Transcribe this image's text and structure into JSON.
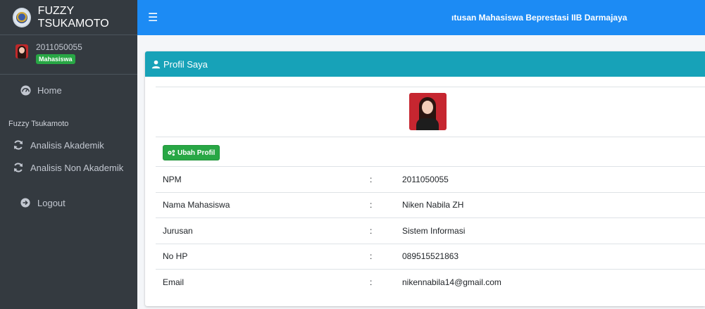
{
  "brand": {
    "name": "FUZZY TSUKAMOTO"
  },
  "user": {
    "id": "2011050055",
    "role_badge": "Mahasiswa"
  },
  "sidebar": {
    "home": "Home",
    "section_header": "Fuzzy Tsukamoto",
    "items": [
      {
        "label": "Analisis Akademik",
        "icon": "sync-icon"
      },
      {
        "label": "Analisis Non Akademik",
        "icon": "sync-icon"
      }
    ],
    "logout": "Logout"
  },
  "topbar": {
    "title": "ıtusan Mahasiswa Beprestasi IIB Darmajaya"
  },
  "card": {
    "header": "Profil Saya",
    "edit_button": "Ubah Profil",
    "fields": [
      {
        "label": "NPM",
        "sep": ":",
        "value": "2011050055"
      },
      {
        "label": "Nama Mahasiswa",
        "sep": ":",
        "value": "Niken Nabila ZH"
      },
      {
        "label": "Jurusan",
        "sep": ":",
        "value": "Sistem Informasi"
      },
      {
        "label": "No HP",
        "sep": ":",
        "value": "089515521863"
      },
      {
        "label": "Email",
        "sep": ":",
        "value": "nikennabila14@gmail.com"
      }
    ]
  },
  "colors": {
    "sidebar": "#343a40",
    "topbar": "#1c8bf4",
    "card_header": "#17a2b8",
    "badge": "#28a745",
    "button": "#28a745"
  }
}
